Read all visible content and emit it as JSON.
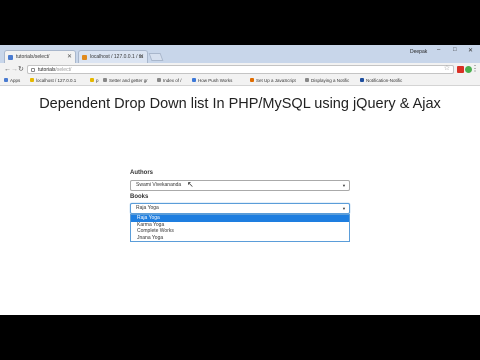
{
  "browser": {
    "tabs": [
      {
        "title": "tutorials/select/"
      },
      {
        "title": "localhost / 127.0.0.1 / tu"
      }
    ],
    "profile_name": "Deepak",
    "window_controls": {
      "minimize": "–",
      "maximize": "□",
      "close": "✕"
    },
    "address": {
      "host": "tutorials",
      "path": "/select/"
    },
    "bookmarks": [
      {
        "label": "Apps"
      },
      {
        "label": "localhost / 127.0.0.1"
      },
      {
        "label": "p"
      },
      {
        "label": "Setter and getter gr"
      },
      {
        "label": "Index of /"
      },
      {
        "label": "How Push Works"
      },
      {
        "label": "Set Up a JavaScript"
      },
      {
        "label": "Displaying a Notific"
      },
      {
        "label": "Notification-Notific"
      }
    ]
  },
  "page": {
    "heading": "Dependent Drop Down list In PHP/MySQL using jQuery & Ajax",
    "authors": {
      "label": "Authors",
      "selected": "Swami Vivekananda"
    },
    "books": {
      "label": "Books",
      "selected": "Raja Yoga",
      "options": [
        "Raja Yoga",
        "Karma Yoga",
        "Complete Works",
        "Jnana Yoga"
      ],
      "highlighted_index": 0
    }
  },
  "colors": {
    "accent": "#1e7ee0",
    "focus_border": "#5b9dd9",
    "tabstrip": "#c8d6ea"
  }
}
